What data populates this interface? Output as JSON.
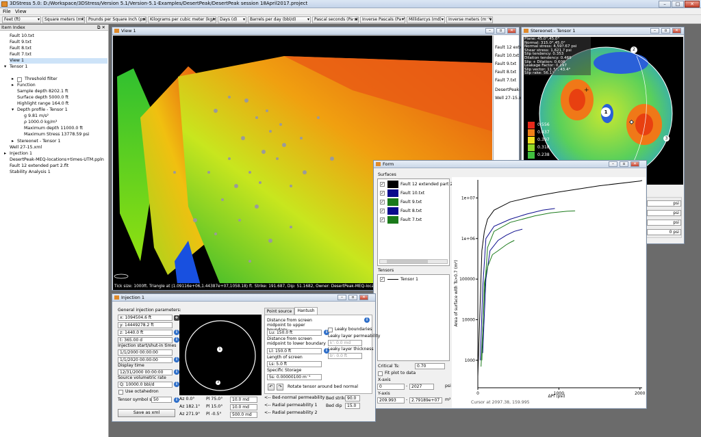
{
  "app": {
    "title": "3DStress 5.0: D:/Workspace/3DStress/Version 5.1/Version-5.1-Examples/DesertPeak/DesertPeak session 18April2017.project"
  },
  "menu": [
    "File",
    "View"
  ],
  "units": [
    "Feet (ft)",
    "Square meters (m²)",
    "Pounds per Square Inch (psi)",
    "Kilograms per cubic meter (kg/m³)",
    "Days (d)",
    "Barrels per day (bbl/d)",
    "Pascal seconds (Pa·s)",
    "Inverse Pascals (Pa⁻¹)",
    "Millidarcys (md)",
    "Inverse meters (m⁻¹)"
  ],
  "index": {
    "title": "Item Index",
    "items": [
      "Fault 10.txt",
      "Fault 9.txt",
      "Fault 8.txt",
      "Fault 7.txt",
      "View 1",
      "Tensor 1",
      "Threshold filter",
      "Function",
      "Sample depth 8202.1 ft",
      "Surface depth 5000.0 ft",
      "Highlight range 164.0 ft",
      "Depth profile - Tensor 1",
      "g 9.81 m/s²",
      "ρ 1000.0 kg/m³",
      "Maximum depth 11000.0 ft",
      "Maximum Stress 13778.59 psi",
      "Stereonet - Tensor 1",
      "Well 27-15.xml",
      "Injection 1",
      "DesertPeak-MEQ-locations+times-UTM.ppln",
      "Fault 12 extended part 2.flt",
      "Stability Analysis 1"
    ]
  },
  "view1": {
    "title": "View 1",
    "status": "Tick size: 1000ft. Triangle at (1.09116e+06,1.44387e+07,1058.18) ft. Strike: 191.687, Dip: 51.1682, Owner: DesertPeak-MEQ-locatio"
  },
  "faultlist": [
    "Fault 12 exten",
    "Fault 10.txt",
    "Fault 9.txt",
    "Fault 8.txt",
    "Fault 7.txt",
    "DesertPeak-M",
    "Well 27-15.xm"
  ],
  "stereonet": {
    "title": "Stereonet - Tensor 1",
    "info": [
      "Plane: 45.0°,45.0°",
      "Normal: 315.0°,45.0°",
      "Normal stress: 4,59?.67 psi",
      "Shear stress: 1,621.? psi",
      "Slip tendency: 0.353",
      "Dilation tendency: 0.469",
      "Slip + Dilation: 0.606",
      "Leakage Factor: 0.197",
      "Slip vector: 11.5°, 43.4°",
      "Slip rake: 56.1°"
    ],
    "legend": [
      "0.556",
      "0.437",
      "0.397",
      "0.318",
      "0.238"
    ],
    "poles": [
      "1",
      "2",
      "3"
    ],
    "psi_rows": [
      "psi",
      "psi",
      "psi",
      "0 psi"
    ]
  },
  "form": {
    "title": "Form",
    "surfaces_label": "Surfaces",
    "surfaces": [
      {
        "name": "Fault 12 extended part 2.flt",
        "color": "#000000"
      },
      {
        "name": "Fault 10.txt",
        "color": "#0a0a8c"
      },
      {
        "name": "Fault 9.txt",
        "color": "#1a7a1a"
      },
      {
        "name": "Fault 8.txt",
        "color": "#0a0a8c"
      },
      {
        "name": "Fault 7.txt",
        "color": "#1a7a1a"
      }
    ],
    "tensors_label": "Tensors",
    "tensors": [
      "Tensor 1"
    ],
    "critical_label": "Critical Ts:",
    "critical_value": "0.70",
    "fit_label": "Fit plot to data",
    "xaxis_label": "X-axis",
    "x_min": "0",
    "x_max": "2027",
    "x_unit": "psi",
    "yaxis_label": "Y-axis",
    "y_min": "209.993",
    "y_max": "2.79189e+07",
    "y_unit": "m²",
    "cursor": "Cursor at 2097.38, 159.995"
  },
  "chart_data": {
    "type": "line",
    "ylabel": "Area of surface with Ts>0.7 (m²)",
    "xlabel": "ΔPf (psi)",
    "xlim": [
      0,
      2027
    ],
    "ylim": [
      209.993,
      27918900
    ],
    "yscale": "log",
    "xticks": [
      "0",
      "1000",
      "2000"
    ],
    "yticks": [
      "1000",
      "10000",
      "100000",
      "1e+06",
      "1e+07"
    ],
    "series": [
      {
        "color": "#000000",
        "x": [
          0,
          50,
          80,
          120,
          200,
          400,
          700,
          1000,
          1500,
          2000,
          2027
        ],
        "y": [
          400,
          500000,
          1500000,
          3000000,
          5000000,
          8000000,
          11000000,
          14000000,
          20000000,
          26000000,
          27000000
        ]
      },
      {
        "color": "#0a0a8c",
        "x": [
          30,
          60,
          100,
          200,
          400,
          600,
          800,
          950
        ],
        "y": [
          1000,
          60000,
          1000000,
          2000000,
          3000000,
          4000000,
          5000000,
          5500000
        ]
      },
      {
        "color": "#1a7a1a",
        "x": [
          40,
          80,
          120,
          200,
          400,
          700,
          900,
          1100,
          1200
        ],
        "y": [
          700,
          40000,
          600000,
          1500000,
          2500000,
          3600000,
          4300000,
          4700000,
          4800000
        ]
      },
      {
        "color": "#0a0a8c",
        "x": [
          60,
          100,
          150,
          250,
          350,
          450,
          550
        ],
        "y": [
          1500,
          100000,
          500000,
          900000,
          1200000,
          1500000,
          1700000
        ]
      },
      {
        "color": "#1a7a1a",
        "x": [
          50,
          80,
          120,
          180,
          250,
          350,
          400,
          450
        ],
        "y": [
          1000,
          80000,
          200000,
          400000,
          500000,
          700000,
          800000,
          900000
        ]
      }
    ]
  },
  "injection": {
    "title": "Injection 1",
    "general": "General injection parameters:",
    "x": "x: 1094504.6 ft",
    "y": "y: 14449278.2 ft",
    "z": "z: 1440.0 ft",
    "t": "t: 365.00 d",
    "times_label": "Injection start/shut-in times",
    "start": "1/1/2000 00:00:00",
    "shutin": "1/1/2020 00:00:00",
    "display_label": "Display time",
    "display": "12/31/2000 00:00:00",
    "rate_label": "Source volumetric rate",
    "rate": "Q: 10000.0 bbl/d",
    "octa": "Use octahedron",
    "symbol_label": "Tensor symbol size:",
    "symbol": "50",
    "save": "Save as xml",
    "az": [
      "Az 0.0°",
      "Az 182.1°",
      "Az 271.9°"
    ],
    "pl": [
      "Pl 75.0°",
      "Pl 15.0°",
      "Pl -0.5°"
    ],
    "md": [
      "10.0 md",
      "10.0 md",
      "500.0 md"
    ],
    "poles": [
      "1",
      "3"
    ],
    "tabs": [
      "Point source",
      "Hantush"
    ],
    "lu_label": "Distance from screen midpoint to upper boundary",
    "lu": "Lu: 150.0 ft",
    "ll_label": "Distance from screen midpoint to lower boundary",
    "ll": "Ll: 150.0 ft",
    "ls_label": "Length of screen",
    "ls": "Ls: 5.0 ft",
    "ss_label": "Specific Storage",
    "ss": "Ss: 0.00000100 m⁻¹",
    "leaky": "Leaky boundaries",
    "klbl": "Leaky layer permeability",
    "k": "k': 0.0 md",
    "blbl": "Leaky layer thickness",
    "b": "b': 0.0 ft",
    "rotate": "Rotate tensor around bed normal",
    "perm": [
      "<-- Bed-normal permeability",
      "<-- Radial permeability 1",
      "<-- Radial permeability 2"
    ],
    "strike_label": "Bed strike",
    "strike": "90.0",
    "dip_label": "Bed dip",
    "dip": "15.0"
  }
}
